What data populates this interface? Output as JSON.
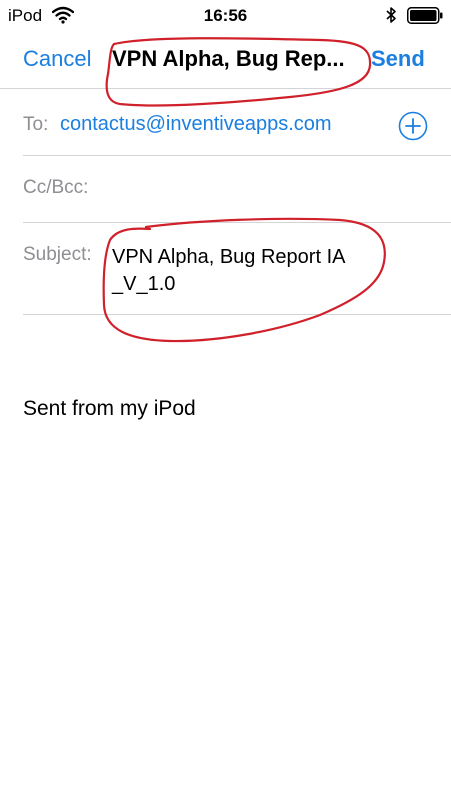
{
  "status_bar": {
    "carrier": "iPod",
    "time": "16:56",
    "icons": [
      "wifi-icon",
      "bluetooth-icon",
      "battery-icon"
    ]
  },
  "nav": {
    "cancel_label": "Cancel",
    "title": "VPN Alpha, Bug Rep...",
    "send_label": "Send"
  },
  "fields": {
    "to_label": "To:",
    "to_value": "contactus@inventiveapps.com",
    "cc_label": "Cc/Bcc:",
    "subject_label": "Subject:",
    "subject_line1": "VPN Alpha, Bug Report IA",
    "subject_line2": "_V_1.0",
    "add_icon": "plus-circle-icon"
  },
  "body": {
    "text": "Sent from my iPod"
  },
  "colors": {
    "accent": "#1a7fe0",
    "label_gray": "#8e8e93",
    "annotation_red": "#d0202a",
    "divider": "#d4d4d8"
  }
}
